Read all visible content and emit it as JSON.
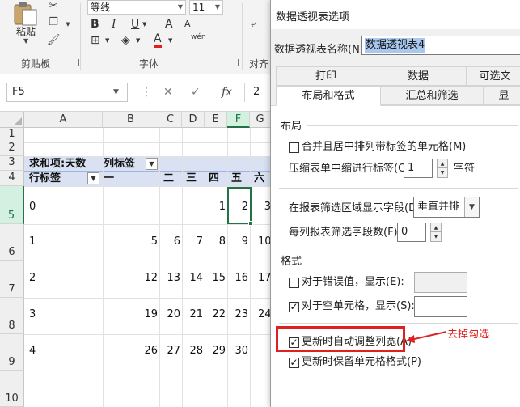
{
  "ribbon": {
    "paste_label": "粘贴",
    "clipboard_group": "剪贴板",
    "font_group": "字体",
    "align_group": "对齐",
    "font_name": "等线",
    "font_size": "11",
    "bold": "B",
    "italic": "I",
    "underline": "U",
    "font_color_letter": "A",
    "grow_font": "A",
    "wen": "wén"
  },
  "formula_bar": {
    "name_box": "F5",
    "cancel": "✕",
    "confirm": "✓",
    "fx": "fx",
    "value": "2"
  },
  "grid": {
    "columns": [
      "A",
      "B",
      "C",
      "D",
      "E",
      "F",
      "G"
    ],
    "rows": [
      "1",
      "2",
      "3",
      "4",
      "5",
      "6",
      "7",
      "8",
      "9",
      "10"
    ],
    "pivot_title": "求和项:天数",
    "col_labels_caption": "列标签",
    "row_labels_caption": "行标签",
    "col_headers": [
      "一",
      "二",
      "三",
      "四",
      "五",
      "六"
    ],
    "row_keys": [
      "0",
      "1",
      "2",
      "3",
      "4"
    ],
    "row_values": [
      [
        "",
        "",
        "",
        "1",
        "2",
        "3"
      ],
      [
        "5",
        "6",
        "7",
        "8",
        "9",
        "10"
      ],
      [
        "12",
        "13",
        "14",
        "15",
        "16",
        "17"
      ],
      [
        "19",
        "20",
        "21",
        "22",
        "23",
        "24"
      ],
      [
        "26",
        "27",
        "28",
        "29",
        "30",
        ""
      ]
    ]
  },
  "dialog": {
    "title": "数据透视表选项",
    "name_label": "数据透视表名称(N):",
    "name_value": "数据透视表4",
    "tabs_row1": [
      "打印",
      "数据",
      "可选文"
    ],
    "tabs_row2": [
      "布局和格式",
      "汇总和筛选",
      "显"
    ],
    "layout_section": "布局",
    "merge_label": "合并且居中排列带标签的单元格(M)",
    "indent_label": "压缩表单中缩进行标签(C):",
    "indent_value": "1",
    "indent_unit": "字符",
    "filter_area_label": "在报表筛选区域显示字段(D):",
    "filter_area_value": "垂直并排",
    "fields_per_col_label": "每列报表筛选字段数(F):",
    "fields_per_col_value": "0",
    "format_section": "格式",
    "error_label": "对于错误值，显示(E):",
    "empty_label": "对于空单元格，显示(S):",
    "autofit_label": "更新时自动调整列宽(A)",
    "preserve_label": "更新时保留单元格格式(P)",
    "checked_mark": "✓"
  },
  "annotation": {
    "text": "去掉勾选",
    "color": "#e02020"
  }
}
